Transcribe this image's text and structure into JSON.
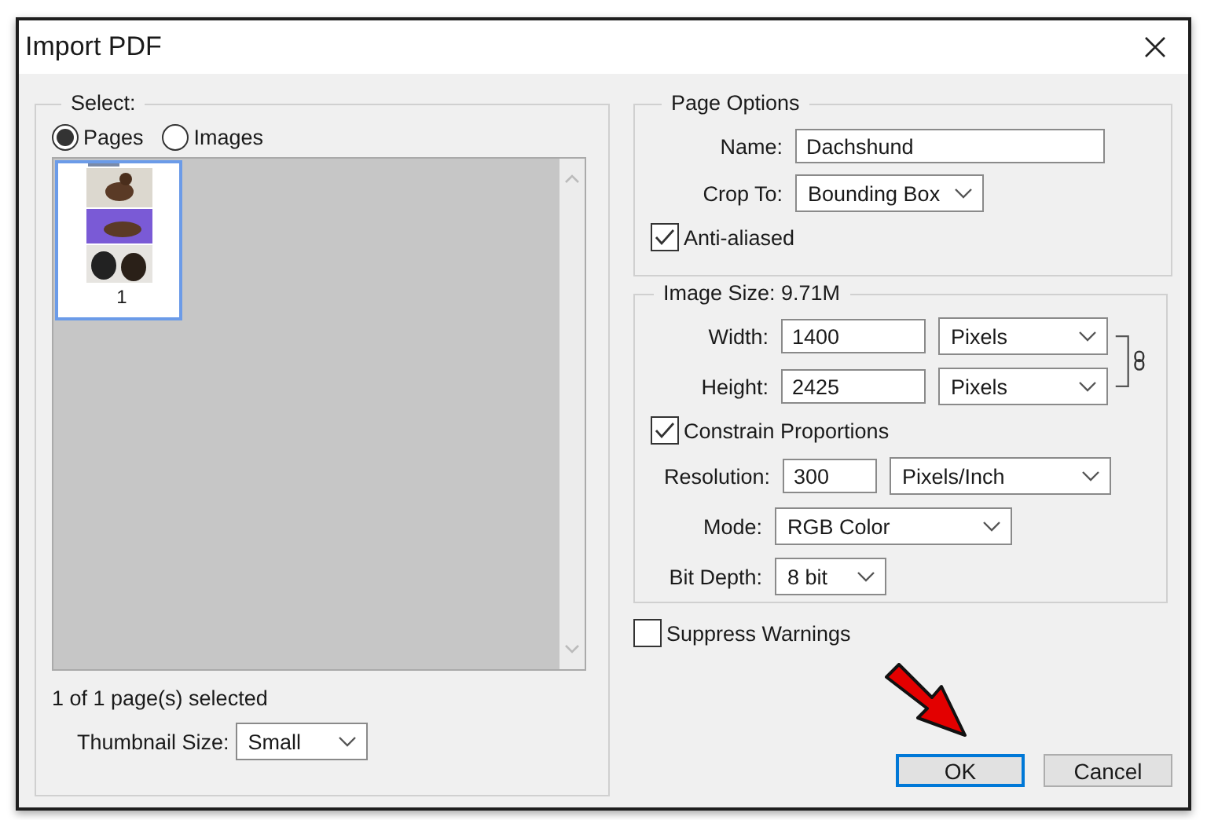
{
  "window": {
    "title": "Import PDF"
  },
  "select": {
    "legend": "Select:",
    "options": [
      {
        "label": "Pages",
        "selected": true
      },
      {
        "label": "Images",
        "selected": false
      }
    ],
    "pages": [
      {
        "number": "1",
        "selected": true
      }
    ],
    "status": "1 of 1 page(s) selected",
    "thumbnail_size": {
      "label": "Thumbnail Size:",
      "value": "Small"
    }
  },
  "page_options": {
    "legend": "Page Options",
    "name": {
      "label": "Name:",
      "value": "Dachshund"
    },
    "crop_to": {
      "label": "Crop To:",
      "value": "Bounding Box"
    },
    "anti_aliased": {
      "label": "Anti-aliased",
      "checked": true
    }
  },
  "image_size": {
    "legend": "Image Size: 9.71M",
    "width": {
      "label": "Width:",
      "value": "1400",
      "unit": "Pixels"
    },
    "height": {
      "label": "Height:",
      "value": "2425",
      "unit": "Pixels"
    },
    "constrain": {
      "label": "Constrain Proportions",
      "checked": true
    },
    "resolution": {
      "label": "Resolution:",
      "value": "300",
      "unit": "Pixels/Inch"
    },
    "mode": {
      "label": "Mode:",
      "value": "RGB Color"
    },
    "bit_depth": {
      "label": "Bit Depth:",
      "value": "8 bit"
    }
  },
  "suppress_warnings": {
    "label": "Suppress Warnings",
    "checked": false
  },
  "buttons": [
    {
      "label": "OK",
      "default": true
    },
    {
      "label": "Cancel",
      "default": false
    }
  ]
}
